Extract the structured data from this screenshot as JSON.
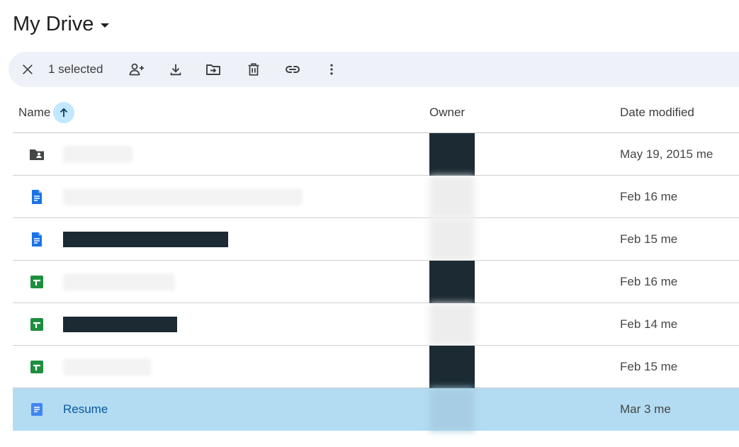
{
  "header": {
    "title": "My Drive"
  },
  "toolbar": {
    "selected_label": "1 selected"
  },
  "columns": {
    "name": "Name",
    "owner": "Owner",
    "date_modified": "Date modified"
  },
  "files": [
    {
      "type": "shared-folder",
      "name": "",
      "redacted": true,
      "date": "May 19, 2015 me"
    },
    {
      "type": "doc",
      "name": "",
      "redacted": true,
      "date": "Feb 16 me"
    },
    {
      "type": "doc",
      "name": "",
      "redacted": true,
      "date": "Feb 15 me"
    },
    {
      "type": "sheet",
      "name": "",
      "redacted": true,
      "date": "Feb 16 me"
    },
    {
      "type": "sheet",
      "name": "",
      "redacted": true,
      "date": "Feb 14 me"
    },
    {
      "type": "sheet",
      "name": "",
      "redacted": true,
      "date": "Feb 15 me"
    },
    {
      "type": "doc",
      "name": "Resume",
      "redacted": false,
      "selected": true,
      "date": "Mar 3 me"
    }
  ],
  "icons": {
    "toolbar": [
      "close-icon",
      "share-icon",
      "download-icon",
      "move-icon",
      "trash-icon",
      "link-icon",
      "more-vert-icon"
    ],
    "sort": "arrow-up-icon",
    "file_types": {
      "shared-folder": "shared-folder-icon",
      "doc": "docs-icon",
      "sheet": "sheets-icon"
    }
  },
  "colors": {
    "selected_row": "#b3dcf2",
    "toolbar_bg": "#eef2f8",
    "sort_highlight": "#c2e7ff",
    "docs_blue": "#1a73e8",
    "sheets_green": "#1e8e3e",
    "redaction": "#1b2a33"
  }
}
